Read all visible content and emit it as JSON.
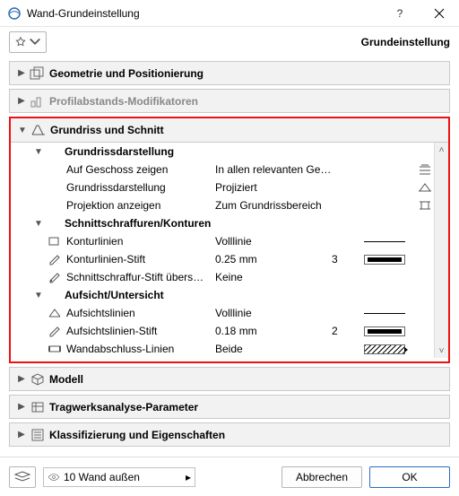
{
  "window": {
    "title": "Wand-Grundeinstellung",
    "subtitle": "Grundeinstellung"
  },
  "sections": {
    "geometry": {
      "label": "Geometrie und Positionierung"
    },
    "profile": {
      "label": "Profilabstands-Modifikatoren"
    },
    "plan": {
      "label": "Grundriss und Schnitt"
    },
    "model": {
      "label": "Modell"
    },
    "struct": {
      "label": "Tragwerksanalyse-Parameter"
    },
    "class": {
      "label": "Klassifizierung und Eigenschaften"
    }
  },
  "plan": {
    "g1": {
      "label": "Grundrissdarstellung"
    },
    "g1r1": {
      "label": "Auf Geschoss zeigen",
      "value": "In allen relevanten Ge…"
    },
    "g1r2": {
      "label": "Grundrissdarstellung",
      "value": "Projiziert"
    },
    "g1r3": {
      "label": "Projektion anzeigen",
      "value": "Zum Grundrissbereich"
    },
    "g2": {
      "label": "Schnittschraffuren/Konturen"
    },
    "g2r1": {
      "label": "Konturlinien",
      "value": "Volllinie"
    },
    "g2r2": {
      "label": "Konturlinien-Stift",
      "value": "0.25 mm",
      "pen": "3"
    },
    "g2r3": {
      "label": "Schnittschraffur-Stift übers…",
      "value": "Keine"
    },
    "g3": {
      "label": "Aufsicht/Untersicht"
    },
    "g3r1": {
      "label": "Aufsichtslinien",
      "value": "Volllinie"
    },
    "g3r2": {
      "label": "Aufsichtslinien-Stift",
      "value": "0.18 mm",
      "pen": "2"
    },
    "g3r3": {
      "label": "Wandabschluss-Linien",
      "value": "Beide"
    }
  },
  "footer": {
    "layer": "10 Wand außen",
    "cancel": "Abbrechen",
    "ok": "OK"
  }
}
